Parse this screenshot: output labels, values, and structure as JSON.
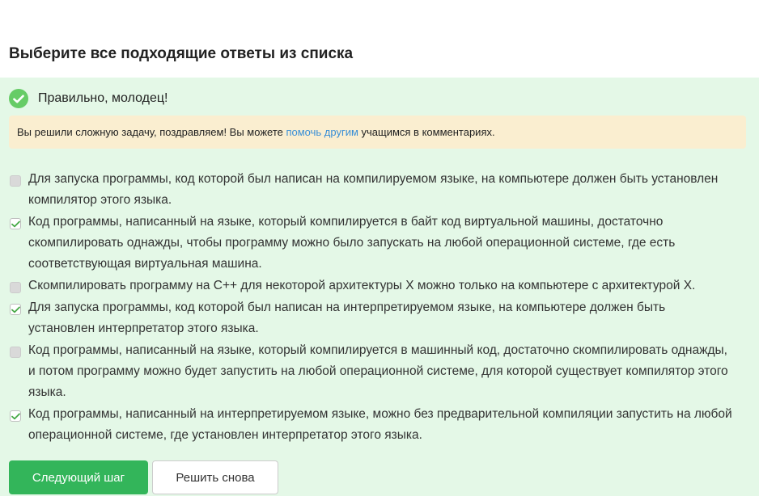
{
  "question": {
    "title": "Выберите все подходящие ответы из списка"
  },
  "feedback": {
    "icon": "check-circle-icon",
    "text": "Правильно, молодец!",
    "hint_before": "Вы решили сложную задачу, поздравляем! Вы можете ",
    "hint_link": "помочь другим",
    "hint_after": " учащимся в комментариях."
  },
  "options": [
    {
      "text": "Для запуска программы, код которой был написан на компилируемом языке, на компьютере должен быть установлен компилятор этого языка.",
      "checked": false
    },
    {
      "text": "Код программы, написанный на языке, который компилируется в байт код виртуальной машины, достаточно скомпилировать однажды, чтобы программу можно было запускать на любой операционной системе, где есть соответствующая виртуальная машина.",
      "checked": true
    },
    {
      "text": "Скомпилировать программу на C++ для некоторой архитектуры X можно только на компьютере с архитектурой X.",
      "checked": false
    },
    {
      "text": "Для запуска программы, код которой был написан на интерпретируемом языке, на компьютере должен быть установлен интерпретатор этого языка.",
      "checked": true
    },
    {
      "text": "Код программы, написанный на языке, который компилируется в машинный код, достаточно скомпилировать однажды, и потом программу можно будет запустить на любой операционной системе, для которой существует компилятор этого языка.",
      "checked": false
    },
    {
      "text": "Код программы, написанный на интерпретируемом языке, можно без предварительной компиляции запустить на любой операционной системе, где установлен интерпретатор этого языка.",
      "checked": true
    }
  ],
  "buttons": {
    "next": "Следующий шаг",
    "retry": "Решить снова"
  },
  "colors": {
    "panel_bg": "#e4f8e7",
    "hint_bg": "#faeed0",
    "success": "#66cc66",
    "primary": "#33b55a",
    "link": "#3a8fd6"
  }
}
